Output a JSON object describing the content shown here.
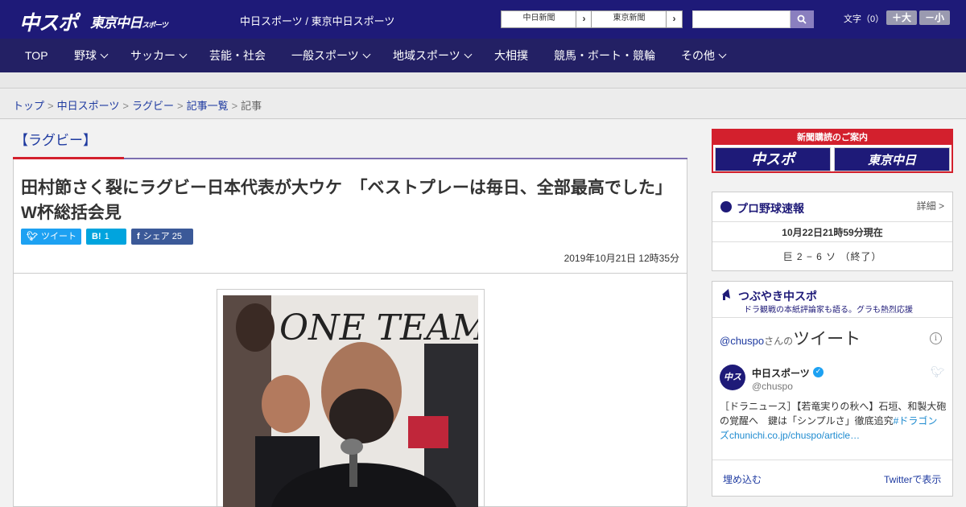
{
  "header": {
    "logo_main": "中スポ",
    "logo_tokyo": "東京中日",
    "logo_tokyo_small": "スポーツ",
    "site_names": "中日スポーツ / 東京中日スポーツ",
    "ext_links": [
      "中日新聞",
      "東京新聞"
    ],
    "search_placeholder": "",
    "font_size_label": "文字（0）",
    "font_plus": "＋大",
    "font_minus": "－小"
  },
  "nav": {
    "items": [
      {
        "label": "TOP",
        "has_menu": false
      },
      {
        "label": "野球",
        "has_menu": true
      },
      {
        "label": "サッカー",
        "has_menu": true
      },
      {
        "label": "芸能・社会",
        "has_menu": false
      },
      {
        "label": "一般スポーツ",
        "has_menu": true
      },
      {
        "label": "地域スポーツ",
        "has_menu": true
      },
      {
        "label": "大相撲",
        "has_menu": false
      },
      {
        "label": "競馬・ボート・競輪",
        "has_menu": false
      },
      {
        "label": "その他",
        "has_menu": true
      }
    ]
  },
  "breadcrumb": {
    "items": [
      "トップ",
      "中日スポーツ",
      "ラグビー",
      "記事一覧"
    ],
    "current": "記事"
  },
  "article": {
    "category": "【ラグビー】",
    "headline": "田村節さく裂にラグビー日本代表が大ウケ　「ベストプレーは毎日、全部最高でした」W杯総括会見",
    "share": {
      "tweet": "ツイート",
      "hatena_icon": "B!",
      "hatena_count": "1",
      "facebook_icon": "f",
      "facebook": "シェア",
      "facebook_count": "25"
    },
    "date": "2019年10月21日 12時35分",
    "photo_banner_text": "ONE TEAM"
  },
  "sidebar": {
    "subscribe": {
      "title": "新聞購読のご案内",
      "left": "中スポ",
      "right": "東京中日"
    },
    "baseball": {
      "title": "プロ野球速報",
      "detail": "詳細 >",
      "time": "10月22日21時59分現在",
      "score": "巨 2 − 6 ソ （終了）"
    },
    "tweets": {
      "title": "つぶやき中スポ",
      "subtitle": "ドラ観戦の本紙評論家も語る。グラも熱烈応援",
      "handle": "@chuspo",
      "handle_suffix": "さんの",
      "heading": "ツイート",
      "info": "i",
      "avatar_text": "中スポ",
      "account_name": "中日スポーツ",
      "account_id": "@chuspo",
      "tweet_text": "［ドラニュース］【若竜実りの秋へ】石垣、和製大砲の覚醒へ　鍵は「シンプルさ」徹底追究",
      "tweet_link": "#ドラゴンズchunichi.co.jp/chuspo/article…",
      "embed": "埋め込む",
      "view_on_twitter": "Twitterで表示"
    }
  },
  "colors": {
    "header_bg": "#1e1a78",
    "nav_bg": "#232064",
    "accent_red": "#d3202d",
    "link_blue": "#1e3aa0",
    "twitter_blue": "#1da1f2",
    "hatena_blue": "#00a4de",
    "facebook_blue": "#3b5998"
  }
}
